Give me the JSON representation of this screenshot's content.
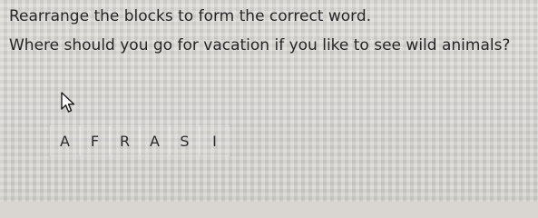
{
  "instruction": "Rearrange the blocks to form the correct word.",
  "question": "Where should you go for vacation if you like to see wild animals?",
  "blocks": [
    "A",
    "F",
    "R",
    "A",
    "S",
    "I"
  ],
  "cursor_icon": "arrow-pointer-icon",
  "colors": {
    "background": "#dad8d4",
    "text": "#262626"
  }
}
